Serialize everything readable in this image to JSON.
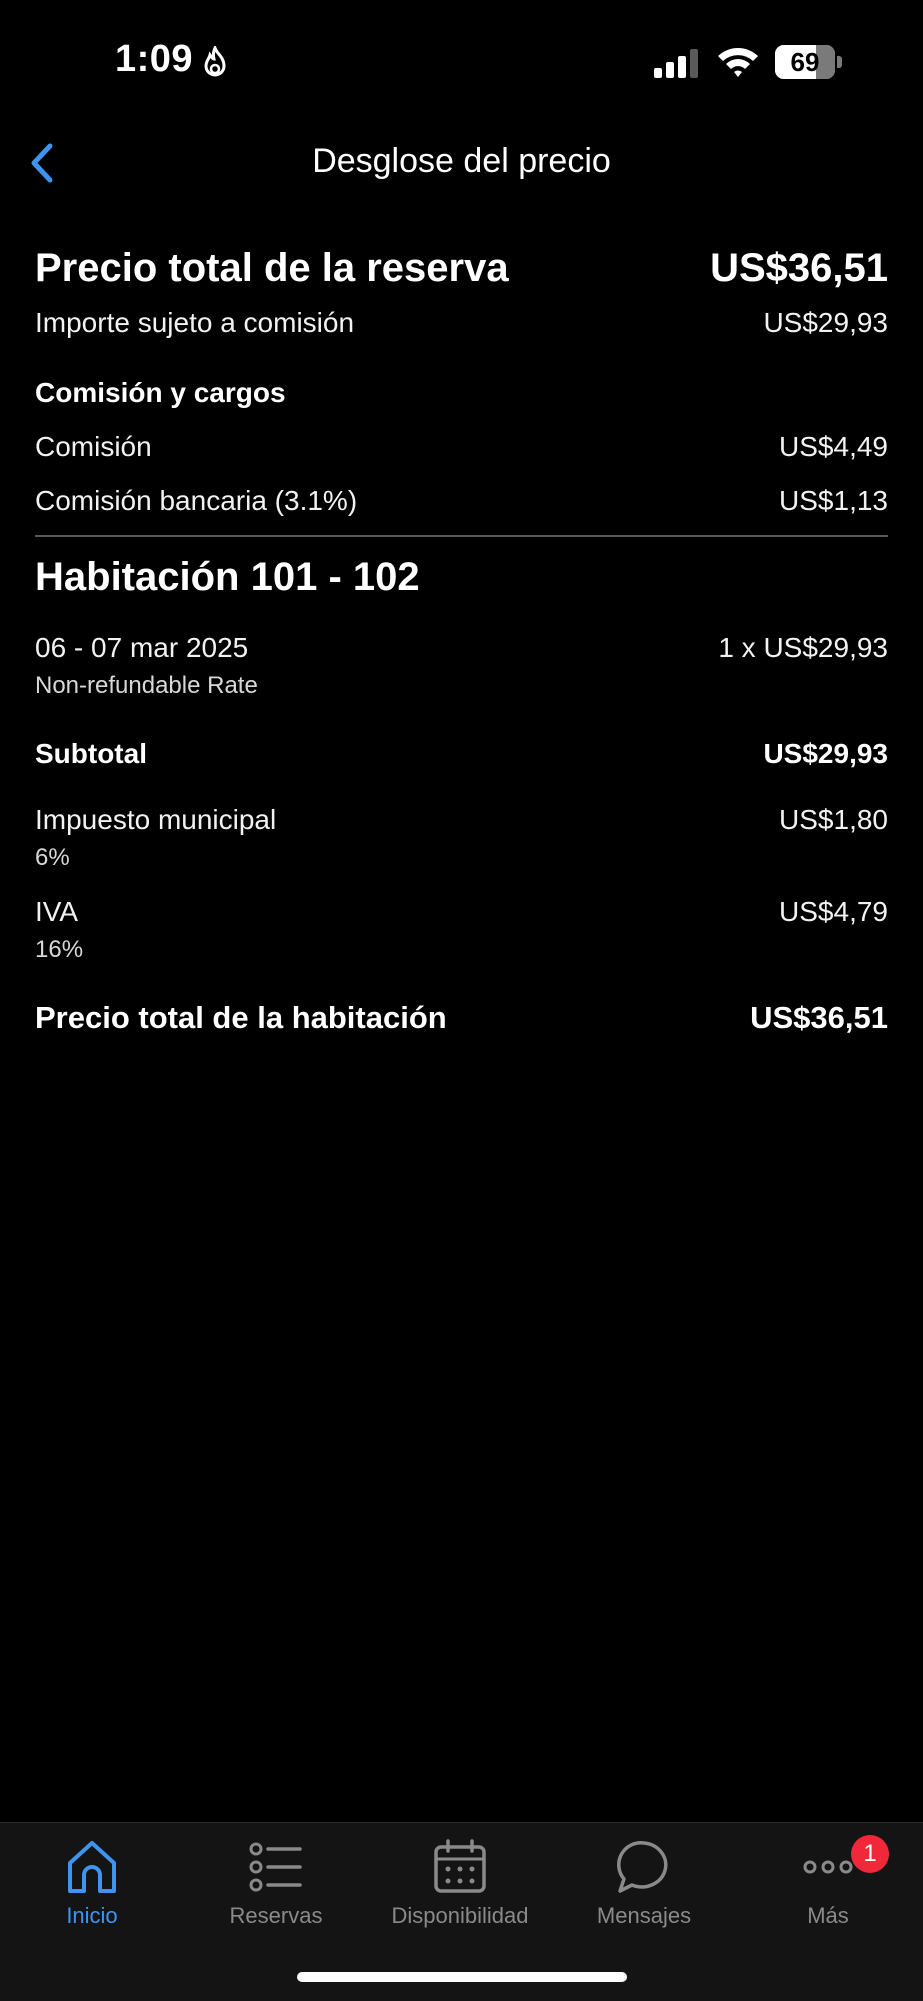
{
  "status_bar": {
    "time": "1:09",
    "battery_percent": "69",
    "battery_level": 0.69
  },
  "header": {
    "title": "Desglose del precio"
  },
  "booking": {
    "total_label": "Precio total de la reserva",
    "total_value": "US$36,51",
    "commissionable_label": "Importe sujeto a comisión",
    "commissionable_value": "US$29,93",
    "fees_heading": "Comisión y cargos",
    "commission_label": "Comisión",
    "commission_value": "US$4,49",
    "bank_fee_label": "Comisión bancaria (3.1%)",
    "bank_fee_value": "US$1,13"
  },
  "room": {
    "title": "Habitación 101 - 102",
    "dates": "06 - 07 mar 2025",
    "rate_name": "Non-refundable Rate",
    "nights_price": "1 x US$29,93",
    "subtotal_label": "Subtotal",
    "subtotal_value": "US$29,93",
    "municipal_tax_label": "Impuesto municipal",
    "municipal_tax_rate": "6%",
    "municipal_tax_value": "US$1,80",
    "vat_label": "IVA",
    "vat_rate": "16%",
    "vat_value": "US$4,79",
    "room_total_label": "Precio total de la habitación",
    "room_total_value": "US$36,51"
  },
  "tabs": [
    {
      "label": "Inicio",
      "icon": "home-icon",
      "active": true
    },
    {
      "label": "Reservas",
      "icon": "list-icon",
      "active": false
    },
    {
      "label": "Disponibilidad",
      "icon": "calendar-icon",
      "active": false
    },
    {
      "label": "Mensajes",
      "icon": "chat-bubble-icon",
      "active": false
    },
    {
      "label": "Más",
      "icon": "more-dots-icon",
      "active": false,
      "badge": "1"
    }
  ],
  "colors": {
    "background": "#000000",
    "accent": "#3f94f0",
    "tab_bar": "#141414",
    "badge": "#f0283a",
    "inactive": "#8a8a8a"
  }
}
